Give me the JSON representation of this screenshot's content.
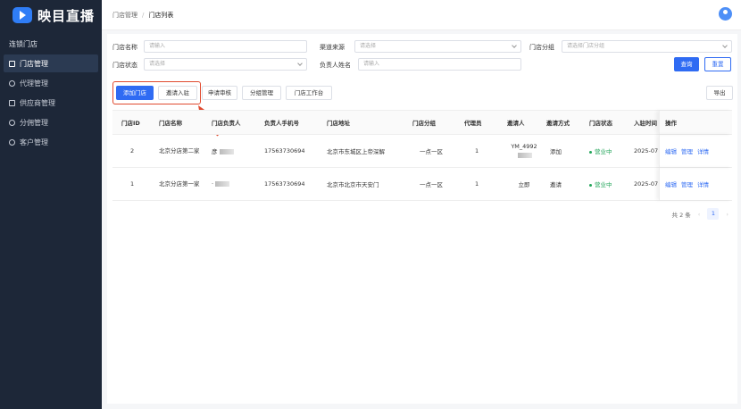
{
  "logo": {
    "text": "映目直播"
  },
  "sidebar": {
    "section": "连锁门店",
    "items": [
      {
        "label": "门店管理",
        "active": true
      },
      {
        "label": "代理管理"
      },
      {
        "label": "供应商管理"
      },
      {
        "label": "分佣管理"
      },
      {
        "label": "客户管理"
      }
    ]
  },
  "breadcrumb": {
    "parent": "门店管理",
    "separator": "/",
    "current": "门店列表"
  },
  "filters": {
    "store_name": {
      "label": "门店名称",
      "placeholder": "请输入"
    },
    "channel": {
      "label": "渠道来源",
      "placeholder": "请选择"
    },
    "group": {
      "label": "门店分组",
      "placeholder": "请选择门店分组"
    },
    "status": {
      "label": "门店状态",
      "placeholder": "请选择"
    },
    "owner": {
      "label": "负责人姓名",
      "placeholder": "请输入"
    },
    "query": "查询",
    "reset": "重置"
  },
  "toolbar": {
    "add": "添加门店",
    "invite": "邀请入驻",
    "audit": "申请审核",
    "group": "分组管理",
    "workbench": "门店工作台",
    "export": "导出"
  },
  "table": {
    "headers": [
      "门店ID",
      "门店名称",
      "门店负责人",
      "负责人手机号",
      "门店地址",
      "门店分组",
      "代理员",
      "邀请人",
      "邀请方式",
      "门店状态",
      "入驻时间",
      "操作"
    ],
    "rows": [
      {
        "id": "2",
        "name": "北京分店第二家",
        "owner": "彦",
        "phone": "17563730694",
        "address": "北京市东城区上帝深解",
        "group": "一点一区",
        "agent": "1",
        "inviter": "YM_4992",
        "method": "添加",
        "status": "营业中",
        "time": "2025-07"
      },
      {
        "id": "1",
        "name": "北京分店第一家",
        "owner": "·",
        "phone": "17563730694",
        "address": "北京市北京市天安门",
        "group": "一点一区",
        "agent": "1",
        "inviter": "立即",
        "method": "邀请",
        "status": "营业中",
        "time": "2025-07"
      }
    ],
    "actions": [
      "编辑",
      "管理",
      "详情"
    ]
  },
  "pagination": {
    "total": "共 2 条",
    "page": "1",
    "prev": "‹",
    "next": "›"
  },
  "colors": {
    "accent": "#2f6bf3",
    "sidebar": "#1d2738",
    "highlight": "#e04a2f",
    "status": "#23a55a"
  }
}
